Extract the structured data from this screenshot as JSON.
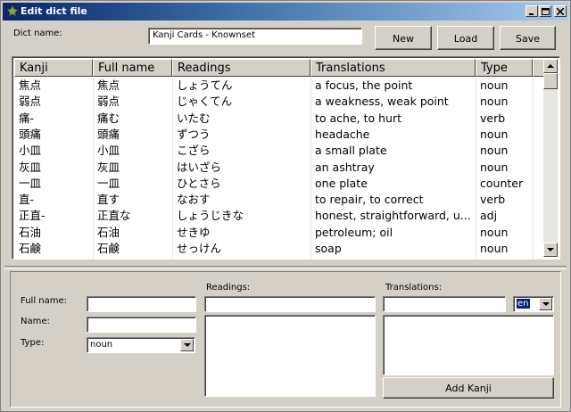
{
  "window": {
    "title": "Edit dict file",
    "controls": {
      "minimize": "minimize",
      "maximize": "maximize",
      "close": "close"
    }
  },
  "header": {
    "dict_name_label": "Dict name:",
    "dict_name_value": "Kanji Cards - Knownset",
    "new_label": "New",
    "load_label": "Load",
    "save_label": "Save"
  },
  "table": {
    "columns": [
      "Kanji",
      "Full name",
      "Readings",
      "Translations",
      "Type"
    ],
    "rows": [
      [
        "焦点",
        "焦点",
        "しょうてん",
        "a focus, the point",
        "noun"
      ],
      [
        "弱点",
        "弱点",
        "じゃくてん",
        "a weakness, weak point",
        "noun"
      ],
      [
        "痛-",
        "痛む",
        "いたむ",
        "to ache, to hurt",
        "verb"
      ],
      [
        "頭痛",
        "頭痛",
        "ずつう",
        "headache",
        "noun"
      ],
      [
        "小皿",
        "小皿",
        "こざら",
        "a small plate",
        "noun"
      ],
      [
        "灰皿",
        "灰皿",
        "はいざら",
        "an ashtray",
        "noun"
      ],
      [
        "一皿",
        "一皿",
        "ひとさら",
        "one plate",
        "counter"
      ],
      [
        "直-",
        "直す",
        "なおす",
        "to repair, to correct",
        "verb"
      ],
      [
        "正直-",
        "正直な",
        "しょうじきな",
        "honest, straightforward, u...",
        "adj"
      ],
      [
        "石油",
        "石油",
        "せきゆ",
        "petroleum; oil",
        "noun"
      ],
      [
        "石鹸",
        "石鹸",
        "せっけん",
        "soap",
        "noun"
      ]
    ]
  },
  "form": {
    "full_name_label": "Full name:",
    "full_name_value": "",
    "name_label": "Name:",
    "name_value": "",
    "type_label": "Type:",
    "type_value": "noun",
    "readings_label": "Readings:",
    "readings_value": "",
    "translations_label": "Translations:",
    "translation_value": "",
    "language_value": "en",
    "add_kanji_label": "Add Kanji"
  },
  "colors": {
    "titlebar_start": "#0a246a",
    "titlebar_end": "#a6caf0",
    "face": "#d4d0c8"
  }
}
